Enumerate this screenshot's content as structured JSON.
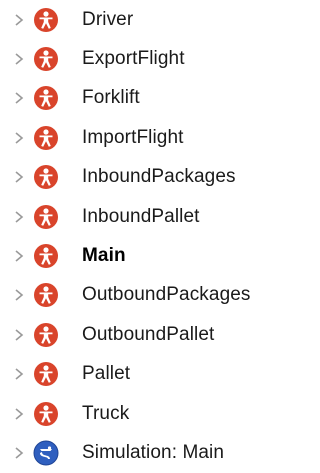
{
  "tree": {
    "items": [
      {
        "label": "Driver",
        "icon": "agent-icon",
        "bold": false
      },
      {
        "label": "ExportFlight",
        "icon": "agent-icon",
        "bold": false
      },
      {
        "label": "Forklift",
        "icon": "agent-icon",
        "bold": false
      },
      {
        "label": "ImportFlight",
        "icon": "agent-icon",
        "bold": false
      },
      {
        "label": "InboundPackages",
        "icon": "agent-icon",
        "bold": false
      },
      {
        "label": "InboundPallet",
        "icon": "agent-icon",
        "bold": false
      },
      {
        "label": "Main",
        "icon": "agent-icon",
        "bold": true
      },
      {
        "label": "OutboundPackages",
        "icon": "agent-icon",
        "bold": false
      },
      {
        "label": "OutboundPallet",
        "icon": "agent-icon",
        "bold": false
      },
      {
        "label": "Pallet",
        "icon": "agent-icon",
        "bold": false
      },
      {
        "label": "Truck",
        "icon": "agent-icon",
        "bold": false
      },
      {
        "label": "Simulation: Main",
        "icon": "simulation-experiment-icon",
        "bold": false
      }
    ]
  },
  "colors": {
    "agent_icon": "#d9442b",
    "simulation_icon": "#2f5fbf",
    "chevron": "#9a9a9a",
    "text": "#1a1a1a"
  }
}
